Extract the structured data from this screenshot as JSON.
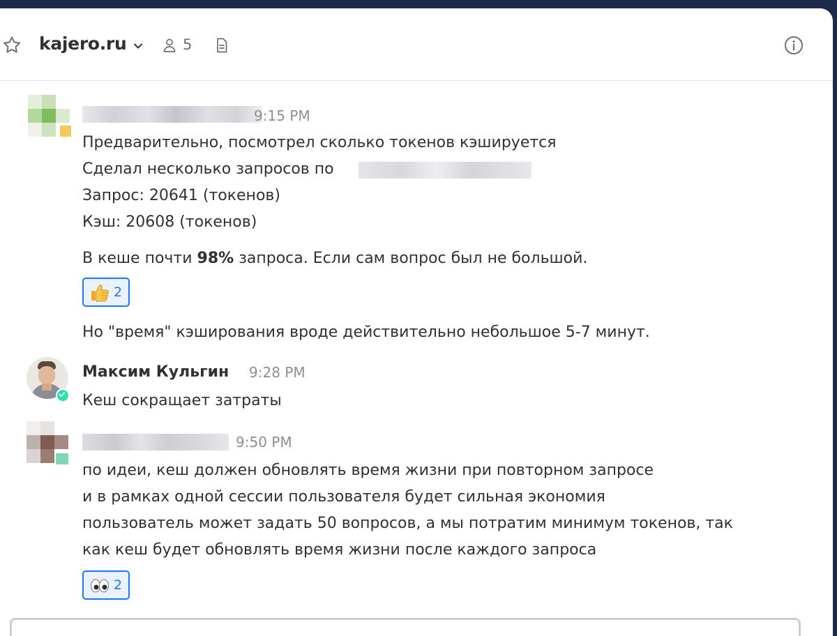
{
  "header": {
    "channel_name": "kajero.ru",
    "member_count": "5",
    "icons": [
      "star-icon",
      "chevron-down-icon",
      "members-icon",
      "files-icon",
      "info-icon"
    ]
  },
  "messages": [
    {
      "time": "9:15 PM",
      "lines": [
        "Предварительно, посмотрел сколько токенов кэшируется",
        "Сделал несколько запросов по",
        "Запрос: 20641 (токенов)",
        "Кэш: 20608 (токенов)"
      ],
      "highlight": {
        "before": "В кеше почти ",
        "bold": "98%",
        "after": " запроса. Если сам вопрос был не большой."
      },
      "reaction": {
        "emoji": "thumbs-up",
        "count": "2"
      },
      "followup": "Но \"время\" кэширования вроде действительно небольшое 5-7 минут."
    },
    {
      "author": "Максим Кульгин",
      "time": "9:28 PM",
      "text": "Кеш сокращает затраты",
      "status": "online"
    },
    {
      "time": "9:50 PM",
      "lines": [
        "по идеи, кеш должен обновлять время жизни при повторном запросе",
        "и в рамках одной сессии пользователя будет сильная экономия",
        "пользователь может задать 50 вопросов, а мы потратим минимум токенов, так",
        "как кеш будет обновлять время жизни после каждого запроса"
      ],
      "reaction": {
        "emoji": "eyes",
        "count": "2"
      }
    }
  ],
  "colors": {
    "accent": "#1d74f5",
    "text": "#2f3133",
    "muted": "#8b8f95",
    "online": "#2de0a5",
    "frame": "#1e2a4a"
  }
}
